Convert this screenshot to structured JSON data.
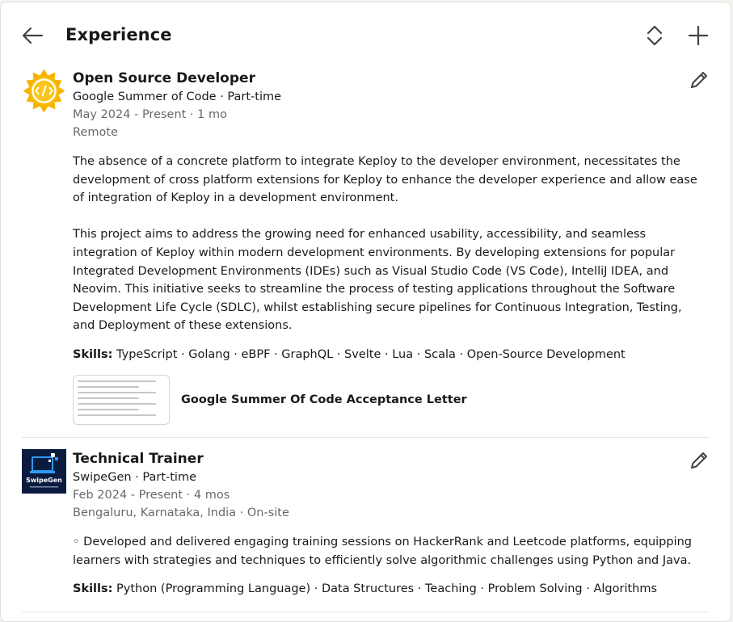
{
  "header": {
    "title": "Experience",
    "icons": {
      "back": "arrow-left-icon",
      "reorder": "reorder-icon",
      "add": "plus-icon",
      "edit": "pencil-icon"
    }
  },
  "entries": [
    {
      "role": "Open Source Developer",
      "company": "Google Summer of Code · Part-time",
      "dates": "May 2024 - Present · 1 mo",
      "location": "Remote",
      "description": [
        "The absence of a concrete platform to integrate Keploy to the developer environment, necessitates the development of cross platform extensions for Keploy to enhance the developer experience and allow ease of integration of Keploy in a development environment.",
        "This project aims to address the growing need for enhanced usability, accessibility, and seamless integration of Keploy within modern development environments. By developing extensions for popular Integrated Development Environments (IDEs) such as Visual Studio Code (VS Code), IntelliJ IDEA, and Neovim. This initiative seeks to streamline the process of testing applications throughout the Software Development Life Cycle (SDLC), whilst establishing secure pipelines for Continuous Integration, Testing, and Deployment of these extensions."
      ],
      "skills_label": "Skills:",
      "skills": "TypeScript · Golang · eBPF · GraphQL · Svelte · Lua · Scala · Open-Source Development",
      "media_title": "Google Summer Of Code Acceptance Letter",
      "logo_color": "#f6b400"
    },
    {
      "role": "Technical Trainer",
      "company": "SwipeGen · Part-time",
      "dates": "Feb 2024 - Present · 4 mos",
      "location": "Bengaluru, Karnataka, India · On-site",
      "description": [
        "◦ Developed and delivered engaging training sessions on HackerRank and Leetcode platforms, equipping learners with strategies and techniques to efficiently solve algorithmic challenges using Python and Java."
      ],
      "skills_label": "Skills:",
      "skills": "Python (Programming Language) · Data Structures · Teaching · Problem Solving · Algorithms",
      "logo_text": "SwipeGen",
      "logo_color": "#0b1b3f"
    }
  ]
}
